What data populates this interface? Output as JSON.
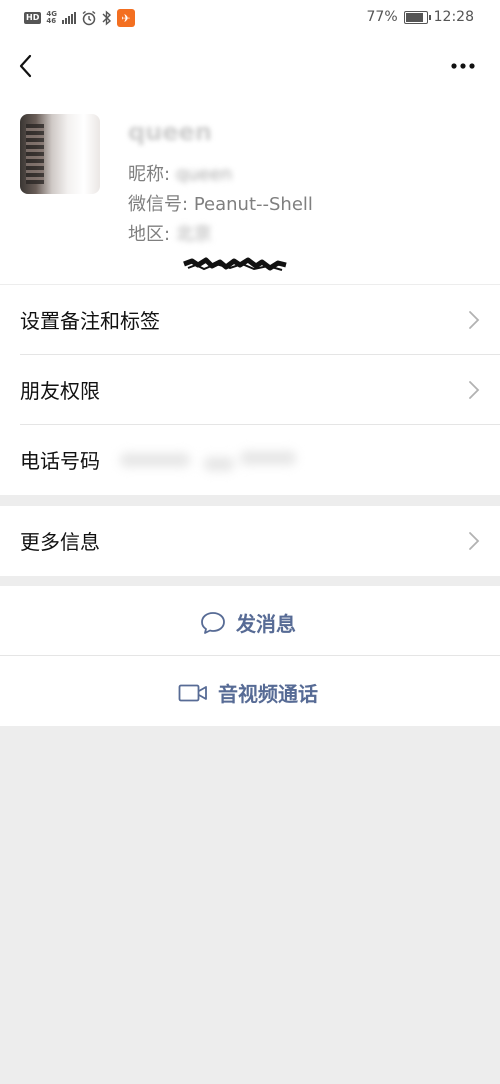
{
  "status_bar": {
    "hd": "HD",
    "network": "4G",
    "network_sub": "46",
    "battery": "77%",
    "time": "12:28"
  },
  "nav": {
    "back_icon": "back-chevron-icon",
    "more_icon": "more-dots-icon"
  },
  "profile": {
    "name": "queen",
    "nickname_label": "昵称:",
    "nickname_value": "queen",
    "wechat_id_label": "微信号:",
    "wechat_id_value": "Peanut--Shell",
    "region_label": "地区:",
    "region_value": "北京"
  },
  "rows": {
    "remark_tags": "设置备注和标签",
    "friend_permissions": "朋友权限",
    "phone_number": "电话号码",
    "more_info": "更多信息"
  },
  "actions": {
    "send_message": "发消息",
    "video_call": "音视频通话"
  },
  "colors": {
    "accent": "#576b95",
    "background": "#ededed",
    "text": "#111111",
    "secondary_text": "#7f7f7f"
  }
}
